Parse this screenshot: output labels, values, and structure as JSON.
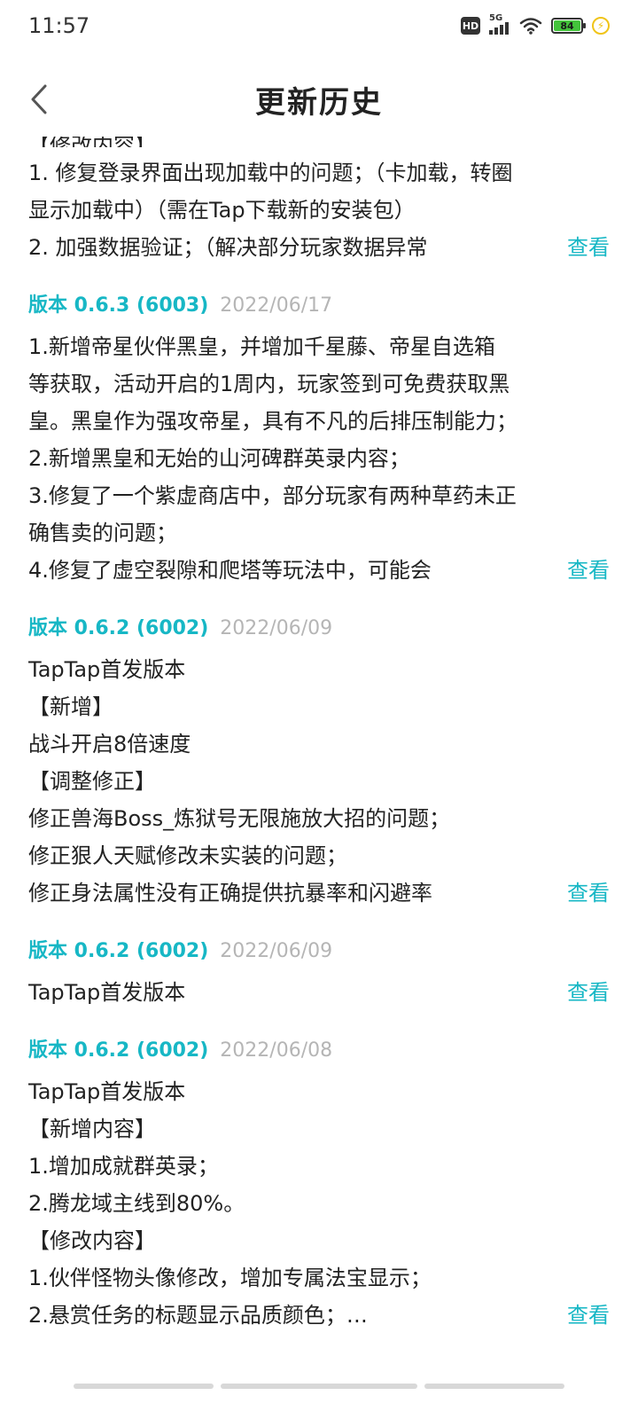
{
  "status_bar": {
    "time": "11:57",
    "hd_label": "HD",
    "network_label": "5G",
    "battery_level": "84",
    "icons": [
      "hd-icon",
      "signal-icon",
      "wifi-icon",
      "battery-icon",
      "charging-icon"
    ]
  },
  "header": {
    "title": "更新历史",
    "back_icon": "chevron-left-icon"
  },
  "colors": {
    "accent": "#17b7c5",
    "date_gray": "#b5b5b5",
    "text": "#222222"
  },
  "view_label": "查看",
  "entries": [
    {
      "version": "",
      "date": "",
      "lines": [
        "1. 修复登录界面出现加载中的问题；（卡加载，转圈",
        "显示加载中）（需在Tap下载新的安装包）",
        "2. 加强数据验证；（解决部分玩家数据异常"
      ]
    },
    {
      "version": "版本 0.6.3 (6003)",
      "date": "2022/06/17",
      "lines": [
        "1.新增帝星伙伴黑皇，并增加千星藤、帝星自选箱",
        "等获取，活动开启的1周内，玩家签到可免费获取黑",
        "皇。黑皇作为强攻帝星，具有不凡的后排压制能力；",
        "2.新增黑皇和无始的山河碑群英录内容；",
        "3.修复了一个紫虚商店中，部分玩家有两种草药未正",
        "确售卖的问题；",
        "4.修复了虚空裂隙和爬塔等玩法中，可能会"
      ]
    },
    {
      "version": "版本 0.6.2 (6002)",
      "date": "2022/06/09",
      "lines": [
        "TapTap首发版本",
        "【新增】",
        "战斗开启8倍速度",
        "【调整修正】",
        "修正兽海Boss_炼狱号无限施放大招的问题；",
        "修正狠人天赋修改未实装的问题；",
        "修正身法属性没有正确提供抗暴率和闪避率"
      ]
    },
    {
      "version": "版本 0.6.2 (6002)",
      "date": "2022/06/09",
      "lines": [
        "TapTap首发版本"
      ]
    },
    {
      "version": "版本 0.6.2 (6002)",
      "date": "2022/06/08",
      "lines": [
        "TapTap首发版本",
        "【新增内容】",
        "1.增加成就群英录；",
        "2.腾龙域主线到80%。",
        "【修改内容】",
        "1.伙伴怪物头像修改，增加专属法宝显示；",
        "2.悬赏任务的标题显示品质颜色；…"
      ]
    }
  ]
}
